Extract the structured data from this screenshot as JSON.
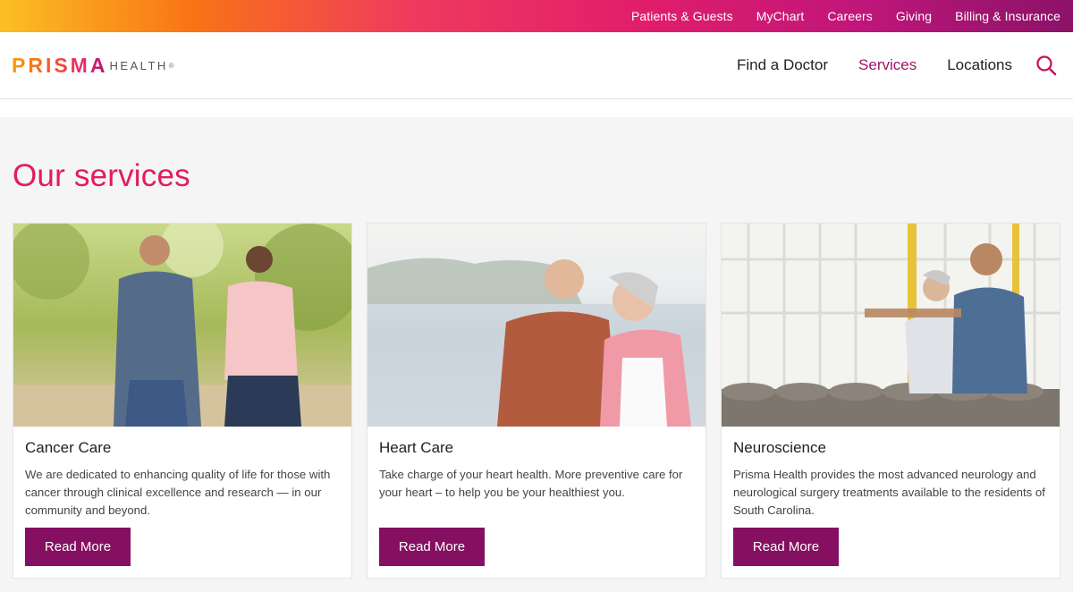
{
  "utility_nav": [
    "Patients & Guests",
    "MyChart",
    "Careers",
    "Giving",
    "Billing & Insurance"
  ],
  "logo": {
    "mark": "PRISMA",
    "sub": "HEALTH",
    "reg": "®"
  },
  "main_nav": {
    "items": [
      "Find a Doctor",
      "Services",
      "Locations"
    ],
    "active": "Services",
    "search_icon": "search-icon"
  },
  "section": {
    "heading": "Our services"
  },
  "cards": [
    {
      "title": "Cancer Care",
      "text": "We are dedicated to enhancing quality of life for those with cancer through clinical excellence and research — in our community and beyond.",
      "button": "Read More"
    },
    {
      "title": "Heart Care",
      "text": "Take charge of your heart health. More preventive care for your heart – to help you be your healthiest you.",
      "button": "Read More"
    },
    {
      "title": "Neuroscience",
      "text": "Prisma Health provides the most advanced neurology and neurological surgery treatments available to the residents of South Carolina.",
      "button": "Read More"
    }
  ],
  "colors": {
    "accent": "#e31c5f",
    "button": "#850f60",
    "nav_active": "#9d1468"
  }
}
